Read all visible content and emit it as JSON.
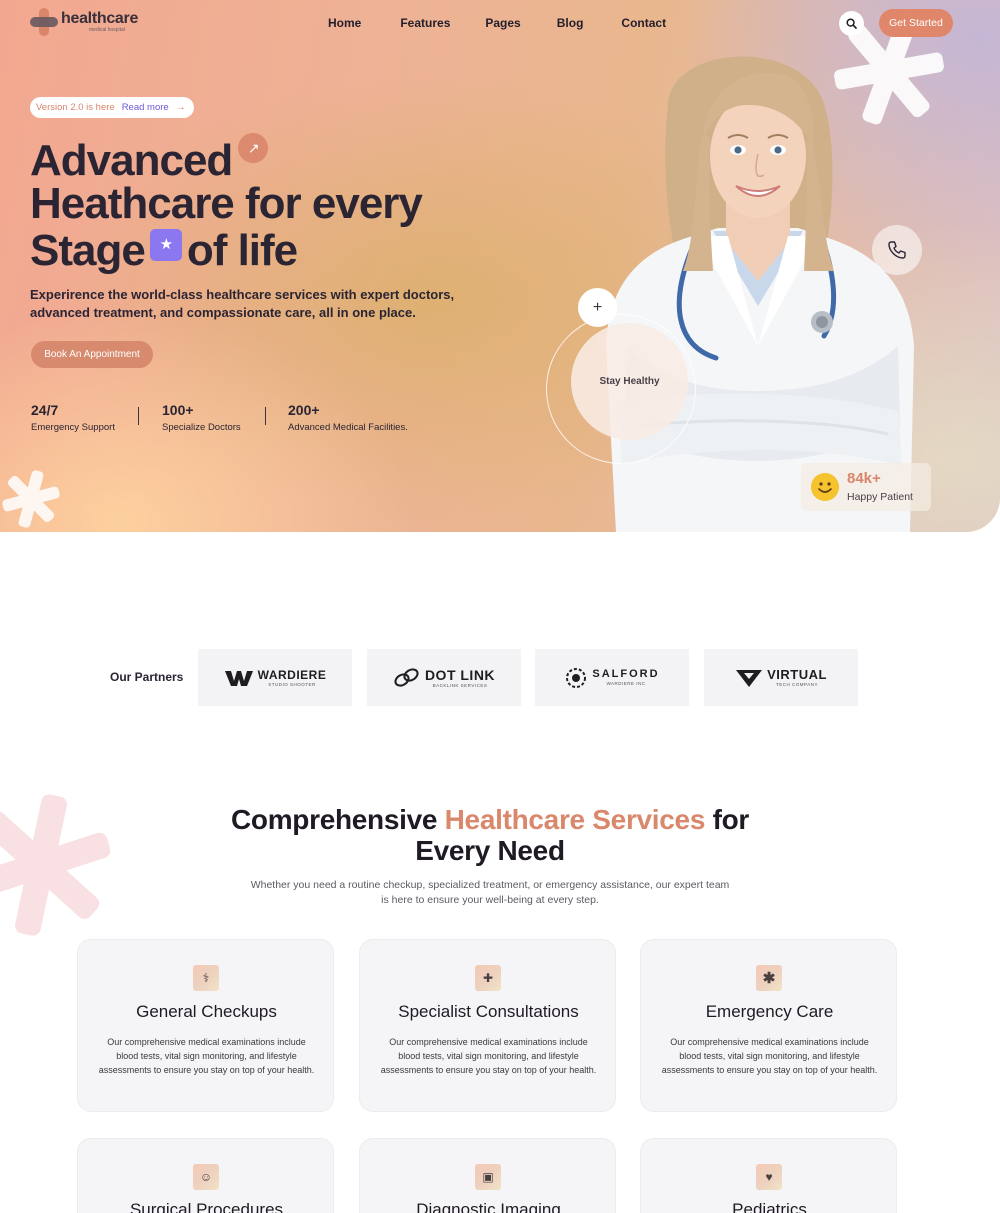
{
  "brand": {
    "name": "healthcare",
    "tagline": "medical hospital"
  },
  "nav": {
    "items": [
      "Home",
      "Features",
      "Pages",
      "Blog",
      "Contact"
    ],
    "cta_label": "Get Started"
  },
  "hero": {
    "version_badge": "Version 2.0 is here",
    "version_link": "Read more",
    "headline_line1": "Advanced",
    "headline_line2": "Heathcare for every",
    "headline_line3a": "Stage",
    "headline_line3b": "of life",
    "subtext": "Experirence the world-class healthcare services with expert doctors, advanced treatment, and compassionate care, all in one place.",
    "book_label": "Book An Appointment",
    "stay_healthy": "Stay Healthy",
    "happy_count": "84k+",
    "happy_label": "Happy Patient",
    "stats": [
      {
        "value": "24/7",
        "label": "Emergency Support"
      },
      {
        "value": "100+",
        "label": "Specialize Doctors"
      },
      {
        "value": "200+",
        "label": "Advanced Medical Facilities."
      }
    ]
  },
  "partners": {
    "label": "Our Partners",
    "items": [
      {
        "name": "WARDIERE",
        "sub": "STUDIO SHOOTER"
      },
      {
        "name": "DOT LINK",
        "sub": "BACKLINK SERVICES"
      },
      {
        "name": "SALFORD",
        "sub": "WARDIERE INC"
      },
      {
        "name": "VIRTUAL",
        "sub": "TECH COMPANY"
      }
    ]
  },
  "services": {
    "title_pre": "Comprehensive ",
    "title_accent": "Healthcare Services",
    "title_post": " for Every Need",
    "description": "Whether you need a routine checkup, specialized treatment, or emergency assistance, our expert team is here to ensure your well-being at every step.",
    "cards": [
      {
        "title": "General Checkups",
        "icon": "stethoscope-icon",
        "desc": "Our comprehensive medical examinations include blood tests, vital sign monitoring, and lifestyle assessments to ensure you stay on top of your health."
      },
      {
        "title": "Specialist Consultations",
        "icon": "medical-cross-icon",
        "desc": "Our comprehensive medical examinations include blood tests, vital sign monitoring, and lifestyle assessments to ensure you stay on top of your health."
      },
      {
        "title": "Emergency Care",
        "icon": "asterisk-icon",
        "desc": "Our comprehensive medical examinations include blood tests, vital sign monitoring, and lifestyle assessments to ensure you stay on top of your health."
      },
      {
        "title": "Surgical Procedures",
        "icon": "mask-icon"
      },
      {
        "title": "Diagnostic Imaging",
        "icon": "image-icon"
      },
      {
        "title": "Pediatrics",
        "icon": "heart-shield-icon"
      }
    ]
  },
  "colors": {
    "accent": "#d9856a",
    "purple": "#8b78f0",
    "link": "#6b5bd6"
  }
}
